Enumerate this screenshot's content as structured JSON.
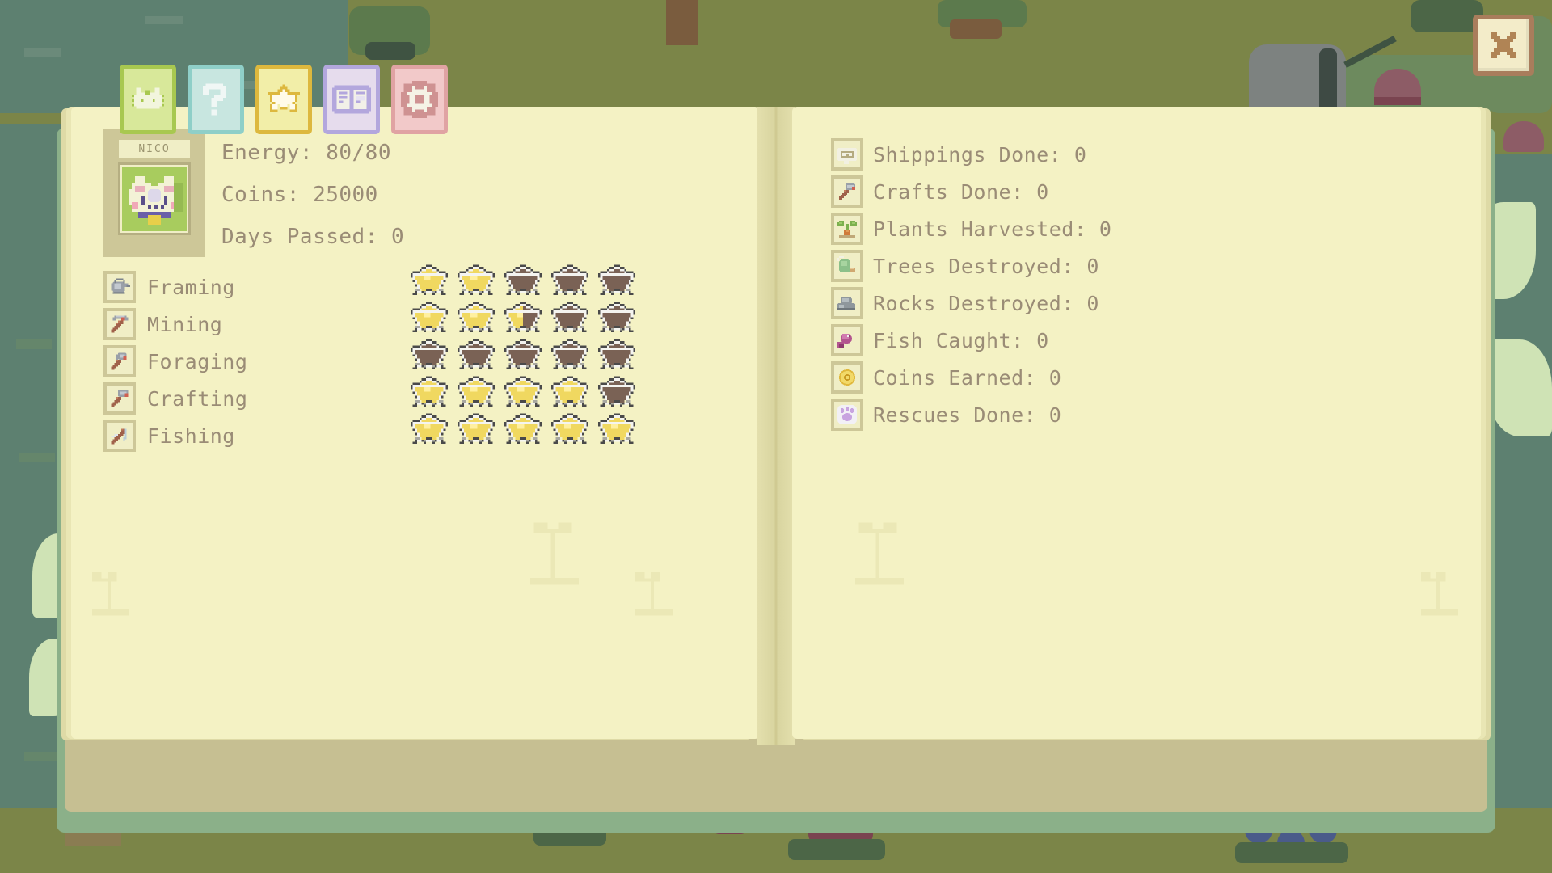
{
  "window": {
    "close_label": "close-button"
  },
  "tabs": [
    {
      "id": "character",
      "icon": "bunny-face-icon",
      "label": "Character",
      "selected": true,
      "bg": "#d8e89a",
      "border": "#a8c850"
    },
    {
      "id": "help",
      "icon": "question-mark-icon",
      "label": "Help",
      "selected": false,
      "bg": "#c8e6e0",
      "border": "#8fcfc8"
    },
    {
      "id": "achievements",
      "icon": "star-icon",
      "label": "Achievements",
      "selected": false,
      "bg": "#f2eea8",
      "border": "#ddb83e"
    },
    {
      "id": "journal",
      "icon": "open-book-icon",
      "label": "Journal",
      "selected": false,
      "bg": "#e6dced",
      "border": "#b3a7dd"
    },
    {
      "id": "settings",
      "icon": "gear-icon",
      "label": "Settings",
      "selected": false,
      "bg": "#f2c9c9",
      "border": "#e0a3a3"
    }
  ],
  "character": {
    "name": "NICO",
    "portrait_icon": "bunny-avatar-icon"
  },
  "player_stats": [
    {
      "key": "energy",
      "text": "Energy: 80/80"
    },
    {
      "key": "coins",
      "text": "Coins: 25000"
    },
    {
      "key": "days_passed",
      "text": "Days Passed: 0"
    }
  ],
  "skills": [
    {
      "name": "Framing",
      "icon": "watering-can-icon",
      "stars_full": 2,
      "stars_partial": 0,
      "stars_max": 5
    },
    {
      "name": "Mining",
      "icon": "pickaxe-icon",
      "stars_full": 2,
      "stars_partial": 0.5,
      "stars_max": 5
    },
    {
      "name": "Foraging",
      "icon": "axe-icon",
      "stars_full": 0,
      "stars_partial": 0,
      "stars_max": 5
    },
    {
      "name": "Crafting",
      "icon": "hammer-icon",
      "stars_full": 4,
      "stars_partial": 0,
      "stars_max": 5
    },
    {
      "name": "Fishing",
      "icon": "fishing-rod-icon",
      "stars_full": 5,
      "stars_partial": 0,
      "stars_max": 5
    }
  ],
  "records": [
    {
      "key": "shippings_done",
      "icon": "mail-icon",
      "text": "Shippings Done: 0"
    },
    {
      "key": "crafts_done",
      "icon": "hammer-icon",
      "text": "Crafts Done: 0"
    },
    {
      "key": "plants_harvested",
      "icon": "sprout-icon",
      "text": "Plants Harvested: 0"
    },
    {
      "key": "trees_destroyed",
      "icon": "tree-icon",
      "text": "Trees Destroyed: 0"
    },
    {
      "key": "rocks_destroyed",
      "icon": "rock-icon",
      "text": "Rocks Destroyed: 0"
    },
    {
      "key": "fish_caught",
      "icon": "fish-icon",
      "text": "Fish Caught: 0"
    },
    {
      "key": "coins_earned",
      "icon": "coin-icon",
      "text": "Coins Earned: 0"
    },
    {
      "key": "rescues_done",
      "icon": "paw-icon",
      "text": "Rescues Done: 0"
    }
  ],
  "colors": {
    "page": "#f4f2c4",
    "text": "#9a8c76",
    "frame": "#cdc798",
    "star_full": "#f0d860",
    "star_empty": "#7a6255",
    "book_base": "#c6bf92",
    "book_cover": "#8bb089",
    "background_water": "#5d8070",
    "background_grass": "#7b8548"
  }
}
